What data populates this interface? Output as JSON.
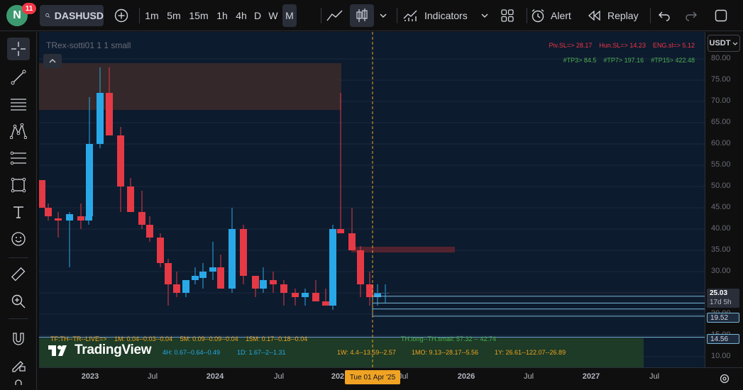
{
  "toolbar": {
    "avatar_letter": "N",
    "notification_count": "11",
    "symbol": "DASHUSD",
    "intervals": [
      "1m",
      "5m",
      "15m",
      "1h",
      "4h",
      "D",
      "W",
      "M"
    ],
    "active_interval": "M",
    "indicators_label": "Indicators",
    "alert_label": "Alert",
    "replay_label": "Replay"
  },
  "chart": {
    "indicator_title": "TRex-sotti01 1 1 small",
    "currency": "USDT",
    "top_right_line1": [
      {
        "text": "Piv.SL=> 28.17",
        "color": "#f23645"
      },
      {
        "text": "Hun.SL=> 14.23",
        "color": "#f23645"
      },
      {
        "text": "ENG.sl=> 5.12",
        "color": "#f23645"
      }
    ],
    "top_right_line2": [
      {
        "text": "#TP3> 84.5",
        "color": "#4caf50"
      },
      {
        "text": "#TP7> 197.16",
        "color": "#4caf50"
      },
      {
        "text": "#TP15> 422.48",
        "color": "#4caf50"
      }
    ],
    "bottom_info": {
      "line1_a": "TF:TH--TR--LIVE=>",
      "line1_b": "1M: 0.04--0.03--0.04",
      "line1_c": "5M: 0.09--0.09--0.04",
      "line1_d": "15M: 0.17--0.18--0.04",
      "line1_e": "TH.long--TH.small: 57.32 -- 42.74",
      "line2_a": "4H: 0.67--0.64--0.49",
      "line2_b": "1D: 1.67--2--1.31",
      "line3_a": "1W: 4.4--13.59--2.57",
      "line3_b": "1MO: 9.13--28.17--5.56",
      "line3_c": "1Y: 26.61--122.07--26.89"
    },
    "watermark": "TradingView",
    "crosshair_date": "Tue 01 Apr '25",
    "colors": {
      "up": "#29a8e8",
      "down": "#e53945",
      "bg": "#0d1b2e"
    }
  },
  "price_axis": {
    "ticks": [
      "80.00",
      "75.00",
      "70.00",
      "65.00",
      "60.00",
      "55.00",
      "50.00",
      "45.00",
      "40.00",
      "35.00",
      "30.00",
      "25.00",
      "20.00",
      "15.00",
      "10.00"
    ],
    "current_price": "25.03",
    "countdown": "17d 5h",
    "tag_19": "19.52",
    "tag_14": "14.56"
  },
  "time_axis": {
    "labels": [
      "2023",
      "Jul",
      "2024",
      "Jul",
      "202",
      "Jul",
      "2026",
      "Jul",
      "2027",
      "Jul"
    ]
  }
}
